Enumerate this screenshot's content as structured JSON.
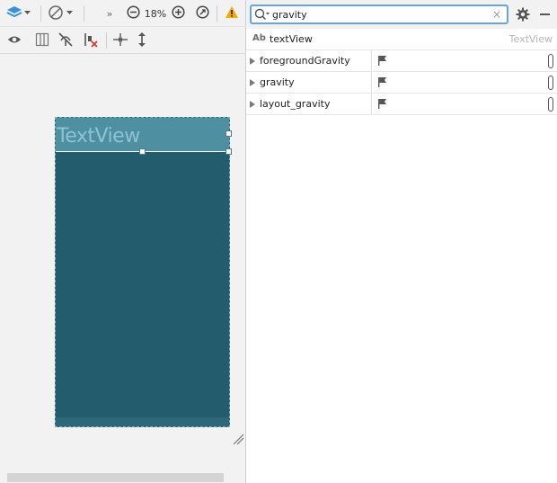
{
  "toolbar": {
    "zoom": "18%",
    "overflow_glyph": "»"
  },
  "preview": {
    "textview_label": "TextView"
  },
  "search": {
    "query": "gravity",
    "clear_glyph": "×"
  },
  "component": {
    "type_badge": "Ab",
    "id": "textView",
    "type": "TextView"
  },
  "attributes": [
    {
      "name": "foregroundGravity"
    },
    {
      "name": "gravity"
    },
    {
      "name": "layout_gravity"
    }
  ],
  "icons": {
    "layers": "layers-icon",
    "orientation": "orientation-icon",
    "zoom_out": "zoom-out-icon",
    "zoom_in": "zoom-in-icon",
    "zoom_fit": "zoom-to-fit-icon",
    "warning": "warning-icon",
    "eye": "eye-icon",
    "blueprint": "blueprint-icon",
    "autoconnect_off": "autoconnect-off-icon",
    "clear_constraints": "clear-constraints-icon",
    "pack_horizontal": "pack-horizontal-icon",
    "pack_vertical": "pack-vertical-icon",
    "search": "search-icon",
    "gear": "gear-icon",
    "flag": "flag-icon"
  },
  "colors": {
    "device_bg": "#235c6c",
    "header_bg": "#4f8fa2",
    "accent": "#6aa4dc",
    "warning": "#f2a900"
  }
}
